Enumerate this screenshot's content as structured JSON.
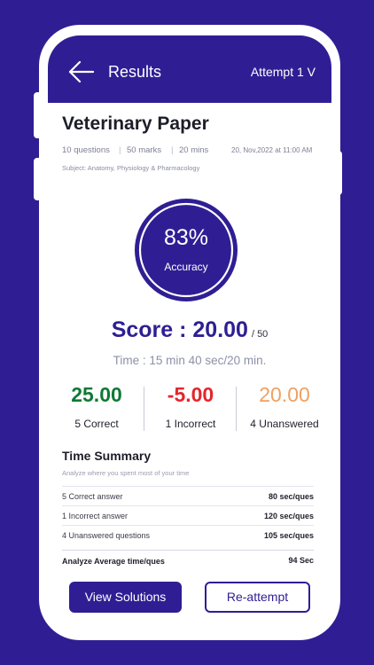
{
  "header": {
    "title": "Results",
    "attempt_label": "Attempt 1  V"
  },
  "paper": {
    "title": "Veterinary Paper",
    "questions": "10 questions",
    "marks": "50 marks",
    "duration": "20 mins",
    "datetime": "20, Nov,2022 at 11:00 AM",
    "subject": "Subject: Anatomy, Physiology & Pharmacology"
  },
  "accuracy": {
    "value": "83%",
    "label": "Accuracy",
    "percent": 83
  },
  "score": {
    "label": "Score : 20.00",
    "total": "/ 50",
    "time": "Time : 15 min  40 sec/20 min."
  },
  "stats": [
    {
      "value": "25.00",
      "label": "5 Correct",
      "color": "#0f7a35"
    },
    {
      "value": "-5.00",
      "label": "1 Incorrect",
      "color": "#e3262c"
    },
    {
      "value": "20.00",
      "label": "4 Unanswered",
      "color": "#f0a060"
    }
  ],
  "time_summary": {
    "title": "Time Summary",
    "subtitle": "Analyze where you spent most of your time",
    "rows": [
      {
        "label": "5 Correct answer",
        "value": "80 sec/ques"
      },
      {
        "label": "1 Incorrect answer",
        "value": "120 sec/ques"
      },
      {
        "label": "4 Unanswered questions",
        "value": "105 sec/ques"
      }
    ],
    "average": {
      "label": "Analyze Average time/ques",
      "value": "94 Sec"
    }
  },
  "buttons": {
    "view_solutions": "View Solutions",
    "reattempt": "Re-attempt"
  },
  "colors": {
    "brand": "#2f1e93",
    "correct": "#0f7a35",
    "incorrect": "#e3262c",
    "unanswered": "#f0a060"
  },
  "icons": {
    "back": "arrow-left-icon"
  }
}
